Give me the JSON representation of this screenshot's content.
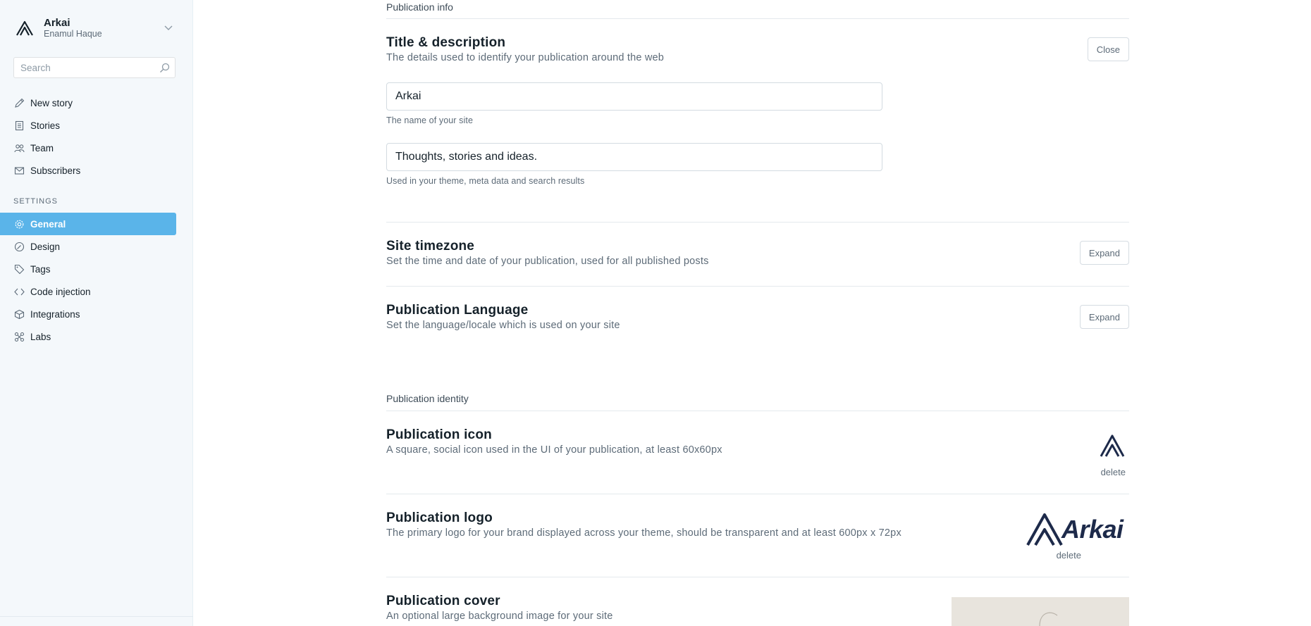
{
  "brand": {
    "name": "Arkai",
    "user": "Enamul Haque"
  },
  "search": {
    "placeholder": "Search"
  },
  "nav_main": [
    {
      "label": "New story",
      "icon": "pencil-icon"
    },
    {
      "label": "Stories",
      "icon": "document-icon"
    },
    {
      "label": "Team",
      "icon": "team-icon"
    },
    {
      "label": "Subscribers",
      "icon": "mail-icon"
    }
  ],
  "settings_label": "SETTINGS",
  "nav_settings": [
    {
      "label": "General",
      "icon": "gear-icon",
      "active": true
    },
    {
      "label": "Design",
      "icon": "palette-icon"
    },
    {
      "label": "Tags",
      "icon": "tag-icon"
    },
    {
      "label": "Code injection",
      "icon": "code-icon"
    },
    {
      "label": "Integrations",
      "icon": "box-icon"
    },
    {
      "label": "Labs",
      "icon": "labs-icon"
    }
  ],
  "publication_info": {
    "label": "Publication info",
    "title_desc": {
      "title": "Title & description",
      "desc": "The details used to identify your publication around the web",
      "button": "Close",
      "name_value": "Arkai",
      "name_hint": "The name of your site",
      "description_value": "Thoughts, stories and ideas.",
      "description_hint": "Used in your theme, meta data and search results"
    },
    "timezone": {
      "title": "Site timezone",
      "desc": "Set the time and date of your publication, used for all published posts",
      "button": "Expand"
    },
    "language": {
      "title": "Publication Language",
      "desc": "Set the language/locale which is used on your site",
      "button": "Expand"
    }
  },
  "publication_identity": {
    "label": "Publication identity",
    "icon": {
      "title": "Publication icon",
      "desc": "A square, social icon used in the UI of your publication, at least 60x60px",
      "delete": "delete"
    },
    "logo": {
      "title": "Publication logo",
      "desc": "The primary logo for your brand displayed across your theme, should be transparent and at least 600px x 72px",
      "logo_text": "Arkai",
      "delete": "delete"
    },
    "cover": {
      "title": "Publication cover",
      "desc": "An optional large background image for your site"
    }
  },
  "colors": {
    "accent": "#5ab4e9",
    "sidebar_bg": "#f4f8fb",
    "text": "#15212a",
    "muted": "#5d6b78"
  }
}
